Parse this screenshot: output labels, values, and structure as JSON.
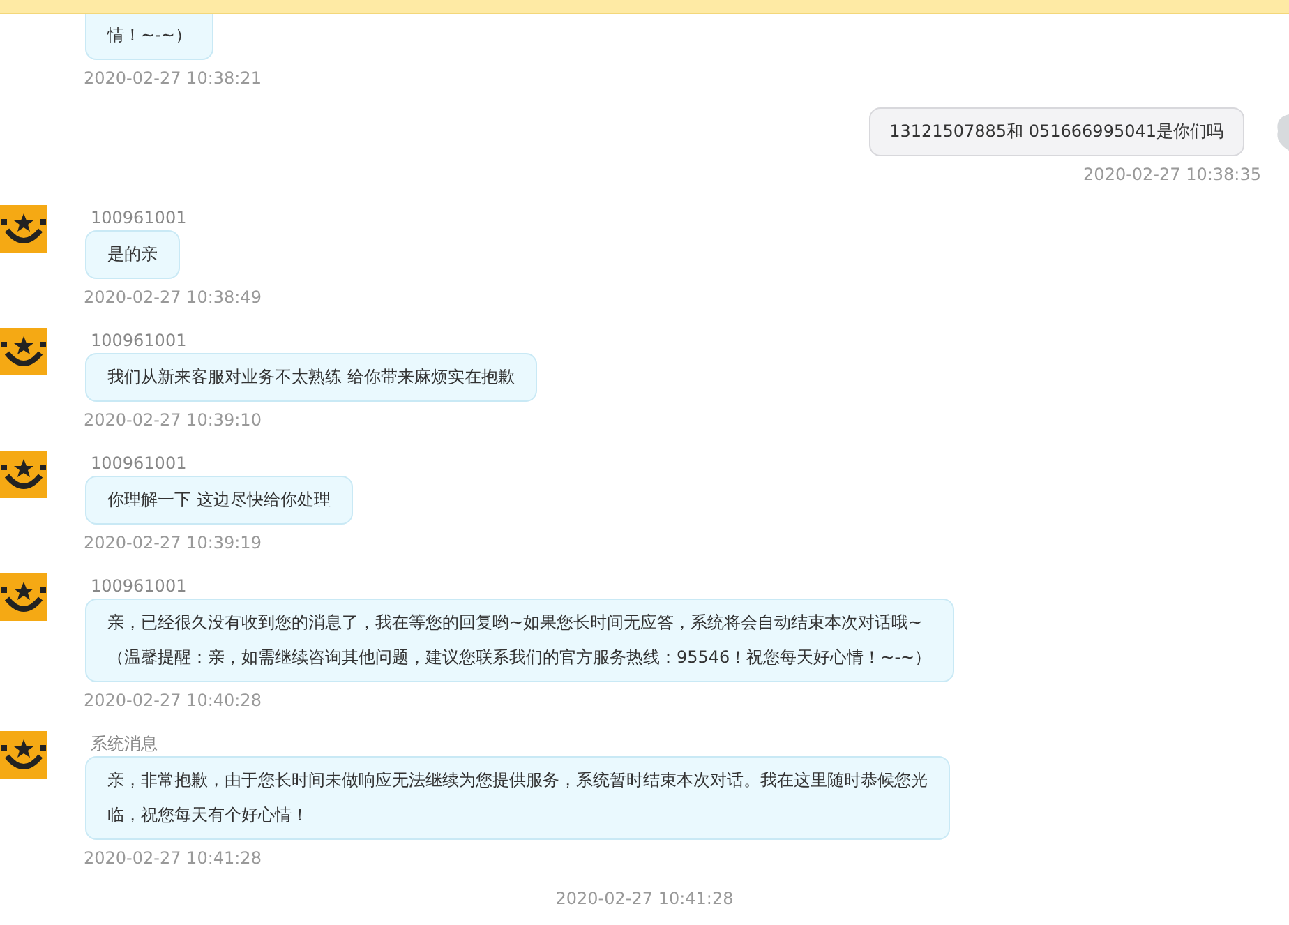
{
  "messages": [
    {
      "kind": "incoming",
      "partial": true,
      "lines": [
        "情！~-~）"
      ],
      "time": "2020-02-27 10:38:21"
    },
    {
      "kind": "outgoing",
      "lines": [
        "13121507885和 051666995041是你们吗"
      ],
      "time": "2020-02-27 10:38:35"
    },
    {
      "kind": "incoming",
      "sender": "100961001",
      "lines": [
        "是的亲"
      ],
      "time": "2020-02-27 10:38:49"
    },
    {
      "kind": "incoming",
      "sender": "100961001",
      "lines": [
        "我们从新来客服对业务不太熟练 给你带来麻烦实在抱歉"
      ],
      "time": "2020-02-27 10:39:10"
    },
    {
      "kind": "incoming",
      "sender": "100961001",
      "lines": [
        "你理解一下 这边尽快给你处理"
      ],
      "time": "2020-02-27 10:39:19"
    },
    {
      "kind": "incoming",
      "sender": "100961001",
      "lines": [
        "亲，已经很久没有收到您的消息了，我在等您的回复哟~如果您长时间无应答，系统将会自动结束本次对话哦~",
        "（温馨提醒：亲，如需继续咨询其他问题，建议您联系我们的官方服务热线：95546！祝您每天好心情！~-~）"
      ],
      "time": "2020-02-27 10:40:28"
    },
    {
      "kind": "incoming",
      "sender": "系统消息",
      "lines": [
        "亲，非常抱歉，由于您长时间未做响应无法继续为您提供服务，系统暂时结束本次对话。我在这里随时恭候您光",
        "临，祝您每天有个好心情！"
      ],
      "time": "2020-02-27 10:41:28"
    },
    {
      "kind": "divider",
      "time": "2020-02-27 10:41:28"
    }
  ]
}
